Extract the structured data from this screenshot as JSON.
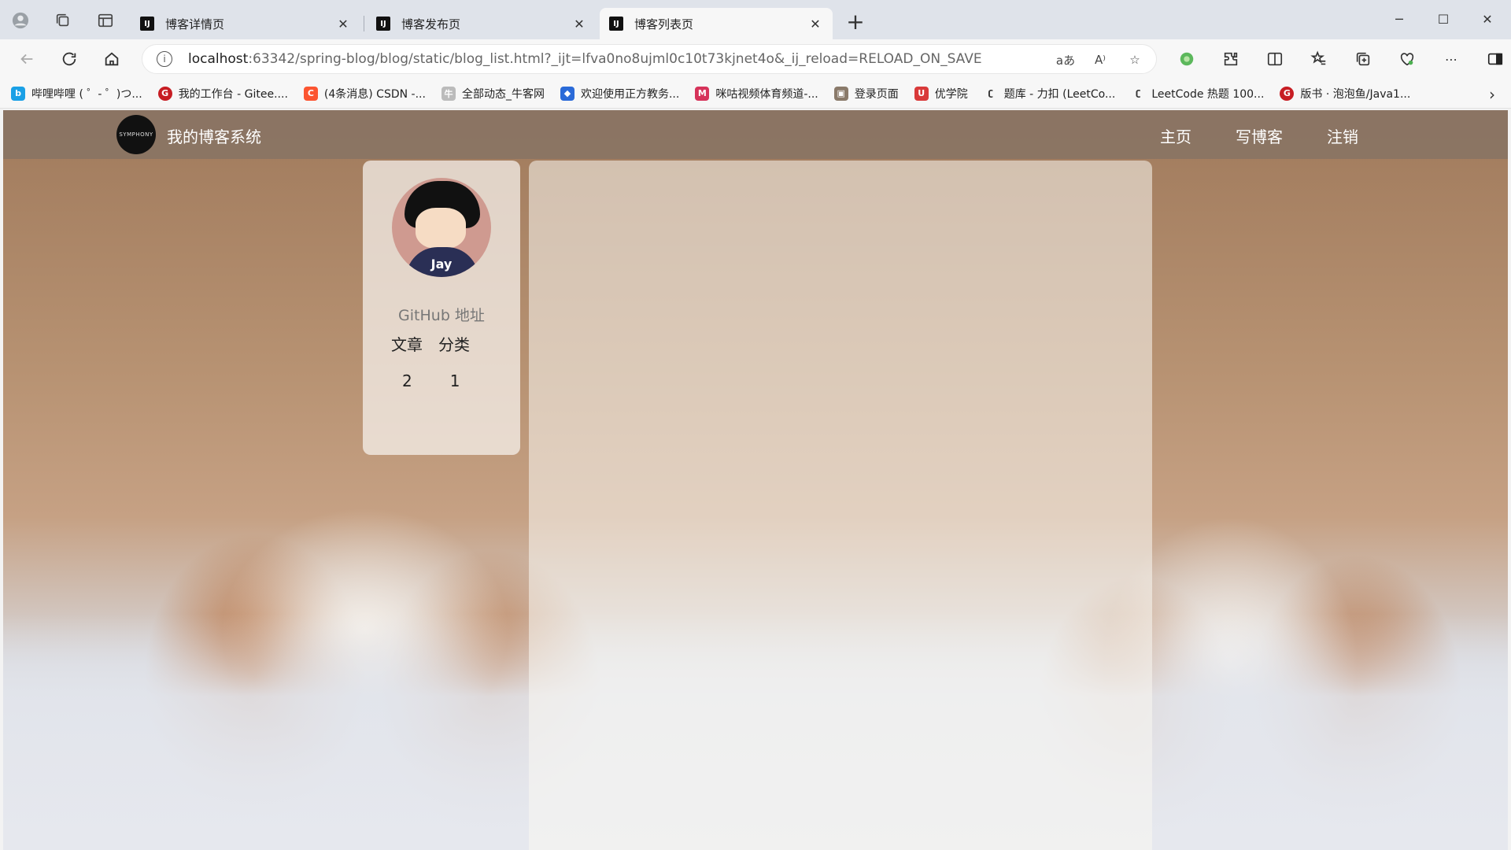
{
  "browser": {
    "tabs": [
      {
        "title": "博客详情页",
        "favicon": "IJ"
      },
      {
        "title": "博客发布页",
        "favicon": "IJ"
      },
      {
        "title": "博客列表页",
        "favicon": "IJ"
      }
    ],
    "address": {
      "host": "localhost",
      "rest": ":63342/spring-blog/blog/static/blog_list.html?_ijt=lfva0no8ujml0c10t73kjnet4o&_ij_reload=RELOAD_ON_SAVE"
    },
    "bookmarks": [
      {
        "label": "哔哩哔哩 ( ゜- ゜)つ...",
        "color": "#1aa0e6",
        "icon": "bilibili-icon"
      },
      {
        "label": "我的工作台 - Gitee....",
        "color": "#c71d23",
        "icon": "gitee-icon"
      },
      {
        "label": "(4条消息) CSDN -...",
        "color": "#fc5531",
        "icon": "csdn-icon"
      },
      {
        "label": "全部动态_牛客网",
        "color": "#888888",
        "icon": "nowcoder-icon"
      },
      {
        "label": "欢迎使用正方教务...",
        "color": "#2a6ad8",
        "icon": "zhengfang-icon"
      },
      {
        "label": "咪咕视频体育频道-...",
        "color": "#d6335a",
        "icon": "migu-icon"
      },
      {
        "label": "登录页面",
        "color": "#777777",
        "icon": "image-icon"
      },
      {
        "label": "优学院",
        "color": "#d93a3a",
        "icon": "ulearning-icon"
      },
      {
        "label": "题库 - 力扣 (LeetCo...",
        "color": "#333333",
        "icon": "leetcode-icon"
      },
      {
        "label": "LeetCode 热题 100...",
        "color": "#333333",
        "icon": "leetcode-icon"
      },
      {
        "label": "版书 · 泡泡鱼/Java1...",
        "color": "#c71d23",
        "icon": "gitee-icon"
      }
    ]
  },
  "site": {
    "logo_text": "SYMPHONY",
    "title": "我的博客系统",
    "nav": [
      "主页",
      "写博客",
      "注销"
    ]
  },
  "profile": {
    "avatar_text": "Jay",
    "github_label": "GitHub 地址",
    "stat_labels": [
      "文章",
      "分类"
    ],
    "stat_values": [
      "2",
      "1"
    ]
  },
  "colors": {
    "nav_bg": "#877364",
    "accent": "#2a2f55"
  }
}
